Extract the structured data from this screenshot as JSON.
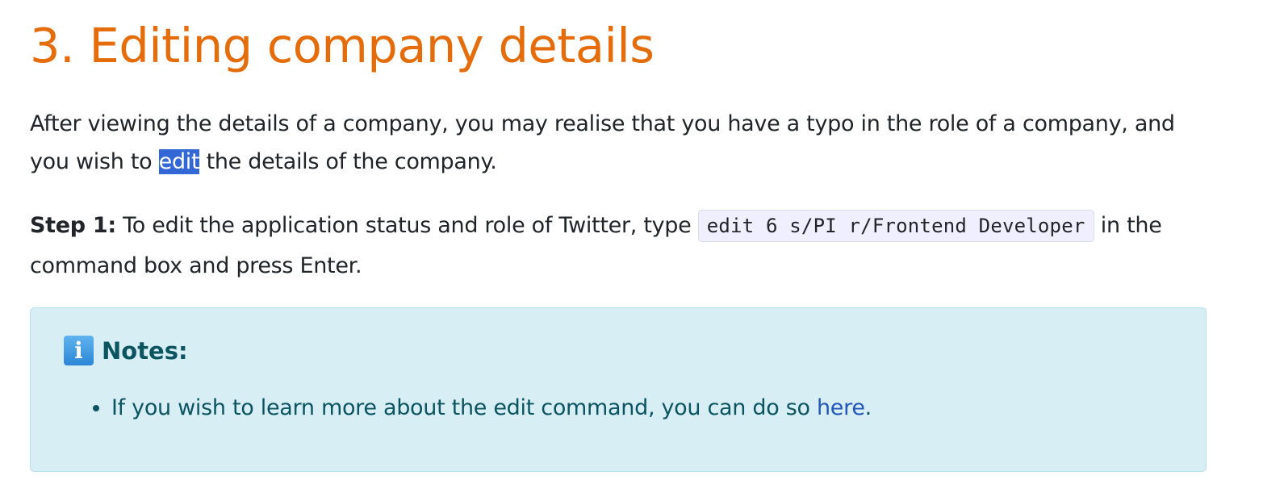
{
  "heading": "3. Editing company details",
  "intro": {
    "before": "After viewing the details of a company, you may realise that you have a typo in the role of a company, and you wish to ",
    "highlight": "edit",
    "after": " the details of the company."
  },
  "step": {
    "label": "Step 1:",
    "before": " To edit the application status and role of Twitter, type ",
    "code": "edit 6 s/PI r/Frontend Developer",
    "after": " in the command box and press Enter."
  },
  "notes": {
    "icon": "info-icon",
    "icon_glyph": "i",
    "title": "Notes:",
    "items": [
      {
        "before": "If you wish to learn more about the edit command, you can do so ",
        "link": "here",
        "after": "."
      }
    ]
  },
  "colors": {
    "heading": "#e46c0a",
    "highlight": "#3367d6",
    "alert_bg": "#d6eef4",
    "alert_text": "#0c5460",
    "link": "#2456b8"
  }
}
